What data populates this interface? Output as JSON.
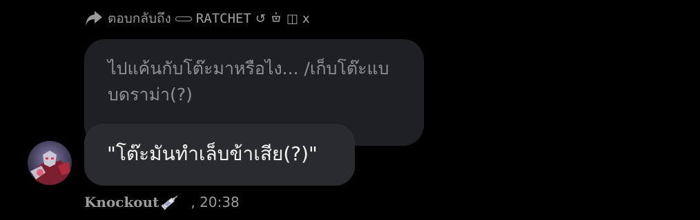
{
  "reply": {
    "label": "ตอบกลับถึง",
    "name": "RATCHET",
    "glyph_1": "↺",
    "glyph_3": "◫",
    "glyph_4": "x"
  },
  "quoted_message": {
    "text": "ไปแค้นกับโต๊ะมาหรือไง... /เก็บโต๊ะแบบดราม่า(?)"
  },
  "message": {
    "text": "\"โต๊ะมันทำเล็บข้าเสีย(?)\""
  },
  "meta": {
    "sender": "Knockout",
    "sender_icon": "syringe-icon",
    "separator": ",",
    "time": "20:38"
  },
  "colors": {
    "background": "#000000",
    "quoted_bubble": "#1f2023",
    "message_bubble": "#2a2b2f",
    "muted_text": "#9a9a9a"
  }
}
